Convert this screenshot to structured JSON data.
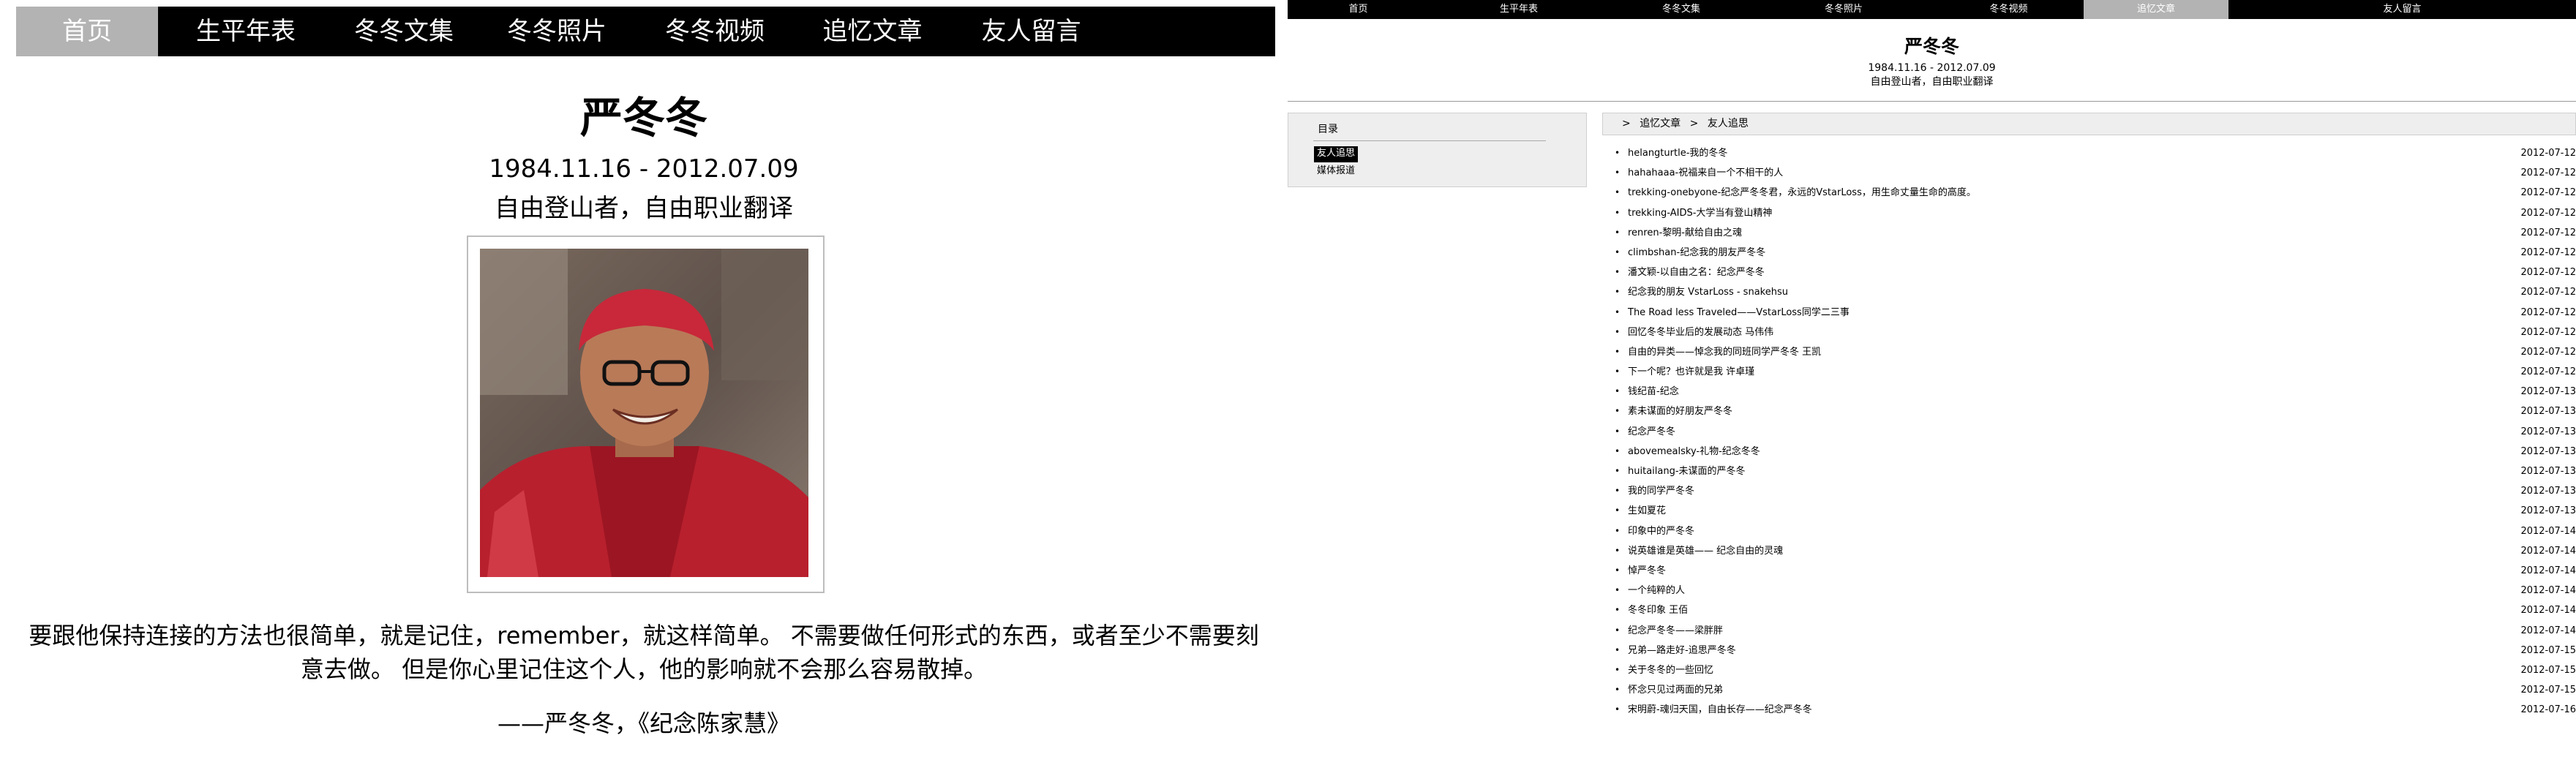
{
  "left": {
    "nav": [
      {
        "label": "首页",
        "active": true
      },
      {
        "label": "生平年表",
        "active": false
      },
      {
        "label": "冬冬文集",
        "active": false
      },
      {
        "label": "冬冬照片",
        "active": false
      },
      {
        "label": "冬冬视频",
        "active": false
      },
      {
        "label": "追忆文章",
        "active": false
      },
      {
        "label": "友人留言",
        "active": false
      }
    ],
    "title": "严冬冬",
    "dates": "1984.11.16 - 2012.07.09",
    "tagline": "自由登山者，自由职业翻译",
    "quote": "要跟他保持连接的方法也很简单，就是记住，remember，就这样简单。 不需要做任何形式的东西，或者至少不需要刻意去做。 但是你心里记住这个人，他的影响就不会那么容易散掉。",
    "attribution": "——严冬冬，《纪念陈家慧》"
  },
  "right": {
    "nav": [
      {
        "label": "首页",
        "active": false
      },
      {
        "label": "生平年表",
        "active": false
      },
      {
        "label": "冬冬文集",
        "active": false
      },
      {
        "label": "冬冬照片",
        "active": false
      },
      {
        "label": "冬冬视频",
        "active": false
      },
      {
        "label": "追忆文章",
        "active": true
      },
      {
        "label": "友人留言",
        "active": false
      }
    ],
    "title": "严冬冬",
    "dates": "1984.11.16 - 2012.07.09",
    "tagline": "自由登山者，自由职业翻译",
    "toc": {
      "title": "目录",
      "items": [
        {
          "label": "友人追思",
          "active": true
        },
        {
          "label": "媒体报道",
          "active": false
        }
      ]
    },
    "breadcrumb": {
      "sep": ">",
      "items": [
        "追忆文章",
        "友人追思"
      ]
    },
    "bullet": "•",
    "articles": [
      {
        "title": "helangturtle-我的冬冬",
        "date": "2012-07-12"
      },
      {
        "title": "hahahaaa-祝福来自一个不相干的人",
        "date": "2012-07-12"
      },
      {
        "title": "trekking-onebyone-纪念严冬冬君，永远的VstarLoss，用生命丈量生命的高度。",
        "date": "2012-07-12"
      },
      {
        "title": "trekking-AIDS-大学当有登山精神",
        "date": "2012-07-12"
      },
      {
        "title": "renren-黎明-献给自由之魂",
        "date": "2012-07-12"
      },
      {
        "title": "climbshan-纪念我的朋友严冬冬",
        "date": "2012-07-12"
      },
      {
        "title": "潘文颖-以自由之名：纪念严冬冬",
        "date": "2012-07-12"
      },
      {
        "title": "纪念我的朋友 VstarLoss - snakehsu",
        "date": "2012-07-12"
      },
      {
        "title": "The Road less Traveled——VstarLoss同学二三事",
        "date": "2012-07-12"
      },
      {
        "title": "回忆冬冬毕业后的发展动态 马伟伟",
        "date": "2012-07-12"
      },
      {
        "title": "自由的异类——悼念我的同班同学严冬冬 王凯",
        "date": "2012-07-12"
      },
      {
        "title": "下一个呢？也许就是我 许卓瑾",
        "date": "2012-07-12"
      },
      {
        "title": "钱纪苗-纪念",
        "date": "2012-07-13"
      },
      {
        "title": "素未谋面的好朋友严冬冬",
        "date": "2012-07-13"
      },
      {
        "title": "纪念严冬冬",
        "date": "2012-07-13"
      },
      {
        "title": "abovemealsky-礼物-纪念冬冬",
        "date": "2012-07-13"
      },
      {
        "title": "huitailang-未谋面的严冬冬",
        "date": "2012-07-13"
      },
      {
        "title": "我的同学严冬冬",
        "date": "2012-07-13"
      },
      {
        "title": "生如夏花",
        "date": "2012-07-13"
      },
      {
        "title": "印象中的严冬冬",
        "date": "2012-07-14"
      },
      {
        "title": "说英雄谁是英雄—— 纪念自由的灵魂",
        "date": "2012-07-14"
      },
      {
        "title": "悼严冬冬",
        "date": "2012-07-14"
      },
      {
        "title": "一个纯粹的人",
        "date": "2012-07-14"
      },
      {
        "title": "冬冬印象 王佰",
        "date": "2012-07-14"
      },
      {
        "title": "纪念严冬冬——梁胖胖",
        "date": "2012-07-14"
      },
      {
        "title": "兄弟—路走好-追思严冬冬",
        "date": "2012-07-15"
      },
      {
        "title": "关于冬冬的一些回忆",
        "date": "2012-07-15"
      },
      {
        "title": "怀念只见过两面的兄弟",
        "date": "2012-07-15"
      },
      {
        "title": "宋明蔚-魂归天国，自由长存——纪念严冬冬",
        "date": "2012-07-16"
      }
    ]
  },
  "colors": {
    "nav_bg": "#000000",
    "nav_active_bg": "#b3b3b3",
    "panel_bg": "#eeeeee"
  }
}
